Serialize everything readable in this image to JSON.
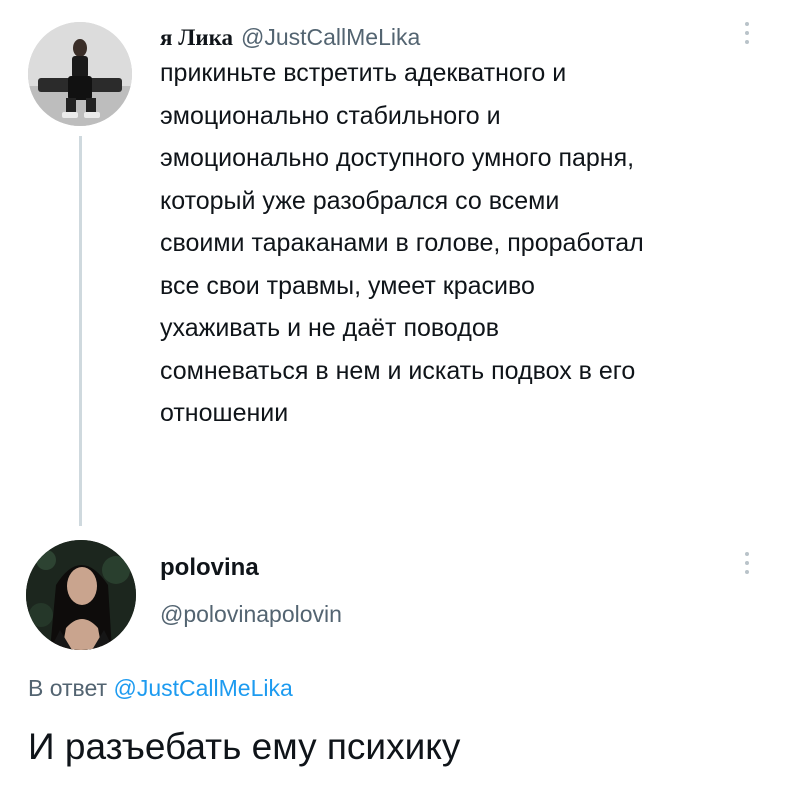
{
  "tweet1": {
    "display_name": "я Лика",
    "handle": "@JustCallMeLika",
    "text": "прикиньте встретить адекватного и\nэмоционально стабильного и\nэмоционально доступного умного парня,\nкоторый уже разобрался со всеми\nсвоими тараканами в голове, проработал\nвсе свои травмы, умеет красиво\nухаживать и не даёт поводов\nсомневаться в нем и искать подвох в его\nотношении",
    "avatar_icon": "avatar-photo"
  },
  "tweet2": {
    "display_name": "polovina",
    "handle": "@polovinapolovin",
    "reply_prefix": "В ответ",
    "reply_mention": "@JustCallMeLika",
    "text": "И разъебать ему психику",
    "avatar_icon": "avatar-photo"
  },
  "colors": {
    "text_primary": "#0f1419",
    "text_secondary": "#536471",
    "link": "#1d9bf0",
    "thread_line": "#cfd9de"
  },
  "icons": {
    "more": "more-vertical-icon"
  }
}
